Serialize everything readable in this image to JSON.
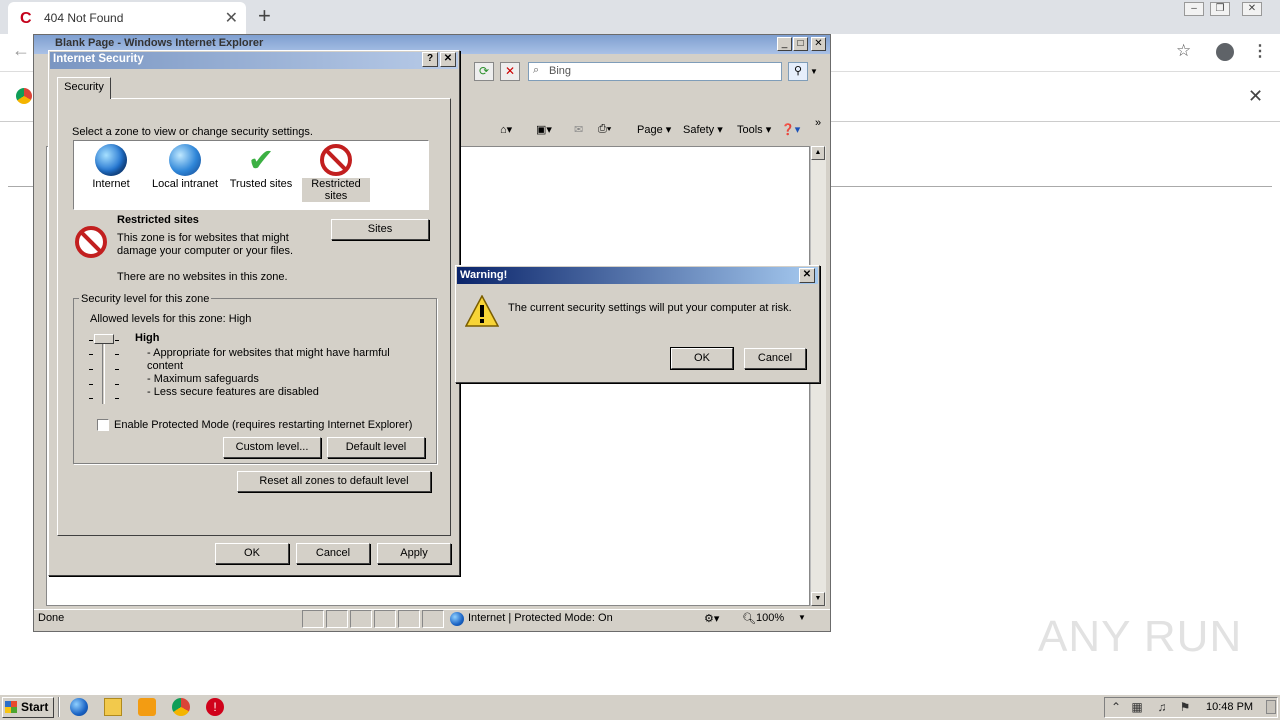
{
  "chrome": {
    "tab_title": "404 Not Found",
    "tab_favicon": "C",
    "close_glyph": "✕",
    "new_tab_glyph": "+",
    "back_glyph": "←",
    "star_glyph": "☆",
    "menu_glyph": "⋮"
  },
  "ie": {
    "window_title": "Blank Page - Windows Internet Explorer",
    "search_placeholder": "Bing",
    "commands": {
      "page": "Page ▾",
      "safety": "Safety ▾",
      "tools": "Tools ▾",
      "chevron": "»"
    },
    "status": {
      "text": "Done",
      "zone": "Internet | Protected Mode: On",
      "zoom": "100%"
    }
  },
  "security_dialog": {
    "title": "Internet Security",
    "tab": "Security",
    "instruction": "Select a zone to view or change security settings.",
    "zones": [
      {
        "label": "Internet",
        "icon": "globe-icon"
      },
      {
        "label": "Local intranet",
        "icon": "network-globe-icon"
      },
      {
        "label": "Trusted sites",
        "icon": "checkmark-icon"
      },
      {
        "label": "Restricted sites",
        "icon": "restricted-icon"
      }
    ],
    "selected_zone": "Restricted sites",
    "zone_heading": "Restricted sites",
    "zone_description": "This zone is for websites that might damage your computer or your files.",
    "zone_note": "There are no websites in this zone.",
    "sites_button": "Sites",
    "group_title": "Security level for this zone",
    "allowed_levels": "Allowed levels for this zone: High",
    "level_name": "High",
    "level_points": [
      "- Appropriate for websites that might have harmful content",
      "- Maximum safeguards",
      "- Less secure features are disabled"
    ],
    "protected_mode_label": "Enable Protected Mode (requires restarting Internet Explorer)",
    "protected_mode_checked": false,
    "custom_level_button": "Custom level...",
    "default_level_button": "Default level",
    "reset_all_button": "Reset all zones to default level",
    "ok_button": "OK",
    "cancel_button": "Cancel",
    "apply_button": "Apply"
  },
  "warning_dialog": {
    "title": "Warning!",
    "message": "The current security settings will put your computer at risk.",
    "ok_button": "OK",
    "cancel_button": "Cancel",
    "icon": "warning-icon"
  },
  "taskbar": {
    "start_label": "Start",
    "clock": "10:48 PM"
  },
  "watermark": "ANY RUN"
}
